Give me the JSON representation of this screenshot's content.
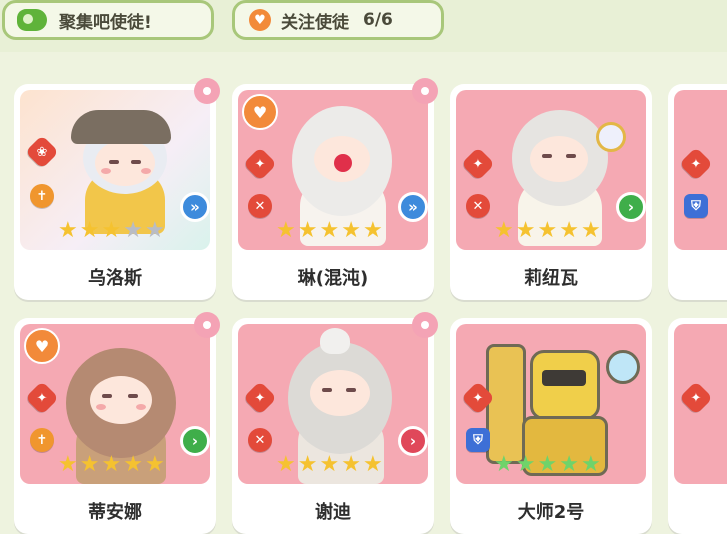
{
  "header": {
    "gather_label": "聚集吧使徒!",
    "follow_label": "关注使徒",
    "follow_count": "6/6"
  },
  "cards": [
    {
      "name": "乌洛斯",
      "stars_filled": 3,
      "stars_total": 5,
      "favorite": false,
      "bg": "#fbe7d3",
      "arrow": "blue"
    },
    {
      "name": "琳(混沌)",
      "stars_filled": 5,
      "stars_total": 5,
      "favorite": true,
      "bg": "#f7b7bd",
      "arrow": "blue"
    },
    {
      "name": "莉纽瓦",
      "stars_filled": 5,
      "stars_total": 5,
      "favorite": false,
      "bg": "#f7b7bd",
      "arrow": "green"
    },
    {
      "name": "蒂安娜",
      "stars_filled": 5,
      "stars_total": 5,
      "favorite": true,
      "bg": "#f7b7bd",
      "arrow": "green"
    },
    {
      "name": "谢迪",
      "stars_filled": 5,
      "stars_total": 5,
      "favorite": false,
      "bg": "#f7b7bd",
      "arrow": "red"
    },
    {
      "name": "大师2号",
      "stars_filled": 5,
      "stars_total": 5,
      "favorite": false,
      "bg": "#f7b7bd",
      "arrow": "none"
    }
  ],
  "colors": {
    "accent_green": "#5fb33a",
    "star_gold": "#f5c230",
    "star_gray": "#b9bcc4",
    "card_pink": "#f7b7bd"
  }
}
